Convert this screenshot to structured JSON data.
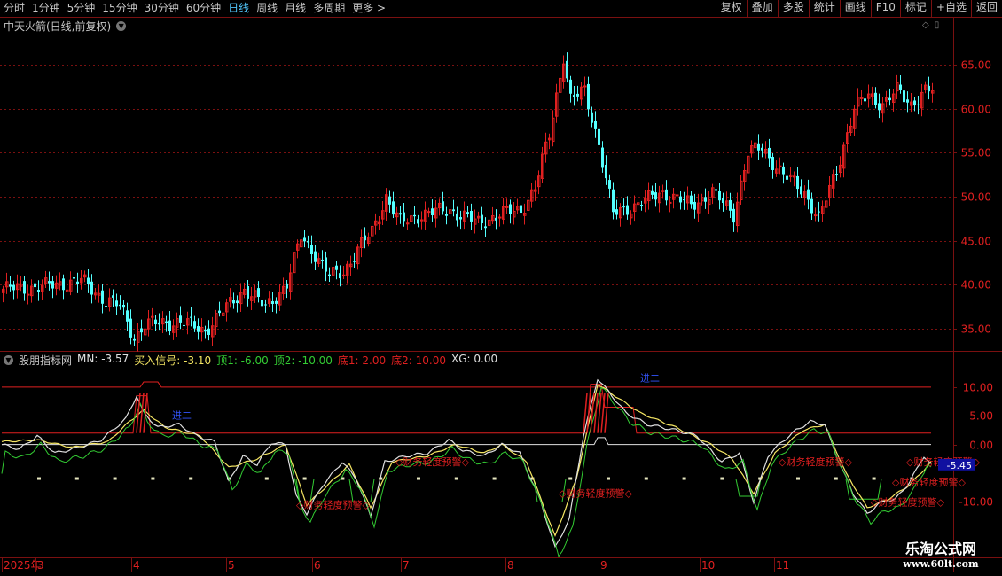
{
  "toolbar": {
    "periods": [
      "分时",
      "1分钟",
      "5分钟",
      "15分钟",
      "30分钟",
      "60分钟",
      "日线",
      "周线",
      "月线",
      "多周期",
      "更多 >"
    ],
    "active_period": "日线",
    "tools": [
      "复权",
      "叠加",
      "多股",
      "统计",
      "画线",
      "F10",
      "标记",
      "+自选",
      "返回"
    ]
  },
  "main_title": "中天火箭(日线,前复权)",
  "indicator": {
    "name": "股朋指标网",
    "items": [
      {
        "label": "MN: -3.57",
        "color": "#e0e0e0"
      },
      {
        "label": "买入信号: -3.10",
        "color": "#f5e663"
      },
      {
        "label": "顶1: -6.00",
        "color": "#33cc33"
      },
      {
        "label": "顶2: -10.00",
        "color": "#33cc33"
      },
      {
        "label": "底1: 2.00",
        "color": "#e02020"
      },
      {
        "label": "底2: 10.00",
        "color": "#e02020"
      },
      {
        "label": "XG: 0.00",
        "color": "#e0e0e0"
      }
    ],
    "current_value": "-5.45",
    "warning_text": "◇财务轻度预警◇",
    "mark_text": "进二"
  },
  "time_axis": [
    "2025年",
    "3",
    "4",
    "5",
    "6",
    "7",
    "8",
    "9",
    "10",
    "11"
  ],
  "watermark": {
    "line1": "乐淘公式网",
    "line2": "www.60lt.com"
  },
  "colors": {
    "up": "#e02020",
    "down": "#54ffff",
    "bg": "#000000",
    "grid": "#7a1010"
  },
  "chart_data": [
    {
      "type": "candlestick",
      "title": "中天火箭(日线,前复权)",
      "ylim": [
        32.5,
        68.5
      ],
      "y_ticks": [
        35,
        40,
        45,
        50,
        55,
        60,
        65
      ],
      "y_tick_labels": [
        "35.00",
        "40.00",
        "45.00",
        "50.00",
        "55.00",
        "60.00",
        "65.00"
      ],
      "x_tick_labels": [
        "2025年",
        "3",
        "4",
        "5",
        "6",
        "7",
        "8",
        "9",
        "10",
        "11"
      ],
      "close_anchors": [
        [
          0,
          39.5
        ],
        [
          12,
          39.8
        ],
        [
          22,
          40.5
        ],
        [
          28,
          38.5
        ],
        [
          33,
          37.5
        ],
        [
          37,
          34.0
        ],
        [
          40,
          35.5
        ],
        [
          50,
          35.8
        ],
        [
          57,
          34.8
        ],
        [
          62,
          37.0
        ],
        [
          68,
          39.5
        ],
        [
          74,
          37.5
        ],
        [
          80,
          40.0
        ],
        [
          84,
          45.5
        ],
        [
          88,
          43.5
        ],
        [
          92,
          41.0
        ],
        [
          96,
          41.5
        ],
        [
          100,
          44.0
        ],
        [
          104,
          46.0
        ],
        [
          108,
          50.0
        ],
        [
          112,
          47.0
        ],
        [
          118,
          48.0
        ],
        [
          126,
          48.5
        ],
        [
          134,
          47.0
        ],
        [
          140,
          48.0
        ],
        [
          146,
          48.5
        ],
        [
          150,
          51.0
        ],
        [
          154,
          57.0
        ],
        [
          158,
          66.0
        ],
        [
          160,
          61.0
        ],
        [
          164,
          62.0
        ],
        [
          168,
          56.0
        ],
        [
          172,
          48.0
        ],
        [
          178,
          49.0
        ],
        [
          186,
          50.5
        ],
        [
          194,
          49.0
        ],
        [
          200,
          50.5
        ],
        [
          206,
          48.0
        ],
        [
          210,
          55.0
        ],
        [
          214,
          55.5
        ],
        [
          220,
          52.5
        ],
        [
          226,
          50.5
        ],
        [
          230,
          47.5
        ],
        [
          235,
          53.0
        ],
        [
          240,
          60.0
        ],
        [
          244,
          61.5
        ],
        [
          248,
          60.5
        ],
        [
          252,
          62.0
        ],
        [
          256,
          60.5
        ],
        [
          260,
          62.0
        ]
      ],
      "amplitude": 0.9
    },
    {
      "type": "line",
      "title": "股朋指标网",
      "ylim": [
        -19.5,
        16
      ],
      "y_ticks": [
        10,
        5,
        0,
        -10
      ],
      "y_tick_labels": [
        "10.00",
        "5.00",
        "0.00",
        "-10.00"
      ],
      "reference_lines": [
        {
          "name": "底2",
          "value": 10.0,
          "color": "#e02020"
        },
        {
          "name": "底1",
          "value": 2.0,
          "color": "#e02020"
        },
        {
          "name": "XG",
          "value": 0.0,
          "color": "#e0e0e0"
        },
        {
          "name": "顶1",
          "value": -6.0,
          "color": "#33cc33"
        },
        {
          "name": "顶2",
          "value": -10.0,
          "color": "#33cc33"
        }
      ],
      "mn_anchors": [
        [
          0,
          0
        ],
        [
          5,
          -0.8
        ],
        [
          10,
          1.5
        ],
        [
          15,
          -1.5
        ],
        [
          22,
          -0.5
        ],
        [
          28,
          0.8
        ],
        [
          35,
          4.5
        ],
        [
          38,
          8.5
        ],
        [
          40,
          5.5
        ],
        [
          44,
          3.0
        ],
        [
          50,
          3.5
        ],
        [
          55,
          1.5
        ],
        [
          60,
          0.5
        ],
        [
          64,
          -6.5
        ],
        [
          68,
          -2.0
        ],
        [
          72,
          -3.5
        ],
        [
          76,
          0.3
        ],
        [
          80,
          0
        ],
        [
          83,
          -9.0
        ],
        [
          86,
          -12.0
        ],
        [
          90,
          -7.5
        ],
        [
          96,
          -3.0
        ],
        [
          100,
          -6.0
        ],
        [
          104,
          -12.5
        ],
        [
          108,
          -3.0
        ],
        [
          114,
          -2.0
        ],
        [
          120,
          -1.5
        ],
        [
          126,
          0.8
        ],
        [
          130,
          -1.0
        ],
        [
          136,
          -2.0
        ],
        [
          141,
          0
        ],
        [
          146,
          -1.5
        ],
        [
          152,
          -10.0
        ],
        [
          156,
          -18.0
        ],
        [
          160,
          -13.0
        ],
        [
          164,
          1.5
        ],
        [
          168,
          11.5
        ],
        [
          172,
          8.5
        ],
        [
          176,
          5.5
        ],
        [
          182,
          3.5
        ],
        [
          190,
          2.5
        ],
        [
          196,
          1.5
        ],
        [
          203,
          -3.0
        ],
        [
          208,
          -1.5
        ],
        [
          212,
          -10.0
        ],
        [
          216,
          -2.0
        ],
        [
          220,
          0.5
        ],
        [
          224,
          2.5
        ],
        [
          228,
          4.0
        ],
        [
          232,
          3.5
        ],
        [
          236,
          -3.0
        ],
        [
          240,
          -8.5
        ],
        [
          244,
          -12.0
        ],
        [
          248,
          -10.0
        ],
        [
          252,
          -9.5
        ],
        [
          256,
          -6.5
        ],
        [
          260,
          -2.0
        ],
        [
          262,
          -3.57
        ]
      ],
      "signal_anchors": [
        [
          0,
          0.5
        ],
        [
          10,
          0.8
        ],
        [
          20,
          -0.5
        ],
        [
          30,
          0.5
        ],
        [
          36,
          4.0
        ],
        [
          40,
          6.0
        ],
        [
          46,
          3.0
        ],
        [
          56,
          1.5
        ],
        [
          64,
          -4.0
        ],
        [
          72,
          -2.5
        ],
        [
          80,
          0
        ],
        [
          86,
          -10.5
        ],
        [
          92,
          -7.0
        ],
        [
          98,
          -3.5
        ],
        [
          104,
          -11.0
        ],
        [
          110,
          -3.0
        ],
        [
          120,
          -2.0
        ],
        [
          128,
          0
        ],
        [
          136,
          -1.5
        ],
        [
          141,
          0
        ],
        [
          148,
          -3.0
        ],
        [
          156,
          -16.0
        ],
        [
          162,
          -6.0
        ],
        [
          168,
          10.5
        ],
        [
          174,
          8.0
        ],
        [
          180,
          5.5
        ],
        [
          190,
          3.0
        ],
        [
          200,
          0
        ],
        [
          206,
          -2.5
        ],
        [
          212,
          -8.5
        ],
        [
          218,
          -1.5
        ],
        [
          226,
          2.5
        ],
        [
          232,
          3.5
        ],
        [
          238,
          -5.0
        ],
        [
          244,
          -11.0
        ],
        [
          250,
          -9.5
        ],
        [
          256,
          -7.0
        ],
        [
          262,
          -3.1
        ]
      ],
      "warning_bars": [
        38,
        39,
        40,
        164,
        165,
        166,
        167,
        168,
        169,
        170
      ],
      "warnings": [
        [
          86,
          -10.5
        ],
        [
          114,
          -3.0
        ],
        [
          160,
          -8.5
        ],
        [
          222,
          -3.0
        ],
        [
          248,
          -10.0
        ],
        [
          254,
          -6.5
        ],
        [
          258,
          -3.0
        ]
      ]
    }
  ]
}
